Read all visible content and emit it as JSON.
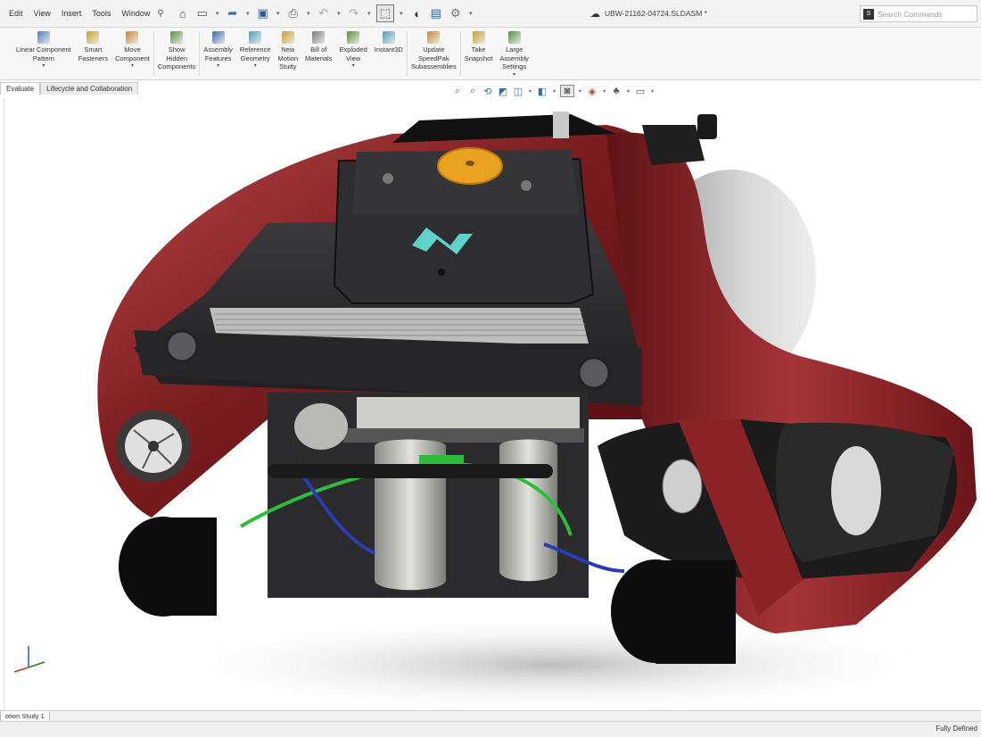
{
  "menu": {
    "items": [
      "Edit",
      "View",
      "Insert",
      "Tools",
      "Window"
    ],
    "pin_icon": "pin-icon"
  },
  "quick_access": [
    "home-icon",
    "new-document-icon",
    "open-icon",
    "save-icon",
    "print-icon",
    "undo-icon",
    "redo-icon",
    "select-icon",
    "rebuild-icon",
    "file-properties-icon",
    "options-icon"
  ],
  "document": {
    "title": "UBW-21162-04724.SLDASM *"
  },
  "search": {
    "placeholder": "Search Commands"
  },
  "ribbon": {
    "buttons": [
      {
        "label": "Linear Component\nPattern",
        "icon": "linear-pattern-icon",
        "has_dropdown": true
      },
      {
        "label": "Smart\nFasteners",
        "icon": "smart-fasteners-icon",
        "has_dropdown": false
      },
      {
        "label": "Move\nComponent",
        "icon": "move-component-icon",
        "has_dropdown": true
      },
      {
        "label": "Show\nHidden\nComponents",
        "icon": "show-hidden-icon",
        "has_dropdown": false
      },
      {
        "label": "Assembly\nFeatures",
        "icon": "assembly-features-icon",
        "has_dropdown": true
      },
      {
        "label": "Reference\nGeometry",
        "icon": "reference-geometry-icon",
        "has_dropdown": true
      },
      {
        "label": "New\nMotion\nStudy",
        "icon": "motion-study-icon",
        "has_dropdown": false
      },
      {
        "label": "Bill of\nMaterials",
        "icon": "bill-of-materials-icon",
        "has_dropdown": false
      },
      {
        "label": "Exploded\nView",
        "icon": "exploded-view-icon",
        "has_dropdown": true
      },
      {
        "label": "Instant3D",
        "icon": "instant3d-icon",
        "has_dropdown": false
      },
      {
        "label": "Update\nSpeedPak\nSubassemblies",
        "icon": "speedpak-icon",
        "has_dropdown": false
      },
      {
        "label": "Take\nSnapshot",
        "icon": "snapshot-icon",
        "has_dropdown": false
      },
      {
        "label": "Large\nAssembly\nSettings",
        "icon": "large-assembly-icon",
        "has_dropdown": true
      }
    ]
  },
  "tabs": [
    "Evaluate",
    "Lifecycle and Collaboration"
  ],
  "active_tab": "Evaluate",
  "heads_up_toolbar": [
    "zoom-to-fit-icon",
    "zoom-to-area-icon",
    "previous-view-icon",
    "section-view-icon",
    "dynamic-annotation-icon",
    "view-orientation-icon",
    "display-style-icon",
    "hide-show-icon",
    "edit-appearance-icon",
    "apply-scene-icon",
    "view-settings-icon"
  ],
  "bottom_tab": "otion Study 1",
  "status": "Fully Defined",
  "colors": {
    "body_red": "#7a1c1f",
    "body_highlight": "#b8474a",
    "dark_panel": "#2b2b2d",
    "hub_orange": "#e8a21f",
    "logo_teal": "#5fd3c9",
    "accent_blue": "#2a5aa5"
  }
}
